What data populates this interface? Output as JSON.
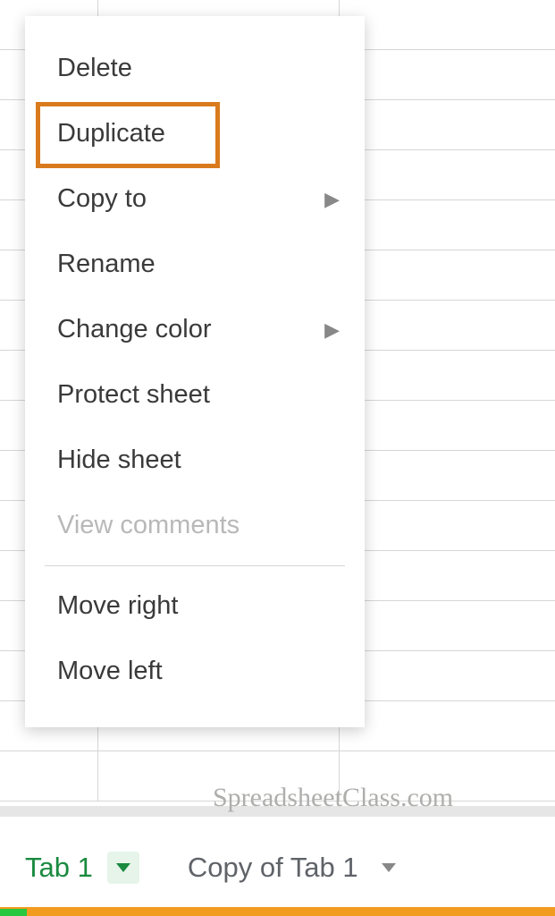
{
  "context_menu": {
    "items": [
      {
        "label": "Delete",
        "has_submenu": false,
        "disabled": false
      },
      {
        "label": "Duplicate",
        "has_submenu": false,
        "disabled": false,
        "highlighted": true
      },
      {
        "label": "Copy to",
        "has_submenu": true,
        "disabled": false
      },
      {
        "label": "Rename",
        "has_submenu": false,
        "disabled": false
      },
      {
        "label": "Change color",
        "has_submenu": true,
        "disabled": false
      },
      {
        "label": "Protect sheet",
        "has_submenu": false,
        "disabled": false
      },
      {
        "label": "Hide sheet",
        "has_submenu": false,
        "disabled": false
      },
      {
        "label": "View comments",
        "has_submenu": false,
        "disabled": true
      }
    ],
    "items_after_divider": [
      {
        "label": "Move right",
        "has_submenu": false,
        "disabled": false
      },
      {
        "label": "Move left",
        "has_submenu": false,
        "disabled": false
      }
    ]
  },
  "sheet_tabs": {
    "active": {
      "label": "Tab 1"
    },
    "inactive": {
      "label": "Copy of Tab 1"
    }
  },
  "watermark": "SpreadsheetClass.com"
}
